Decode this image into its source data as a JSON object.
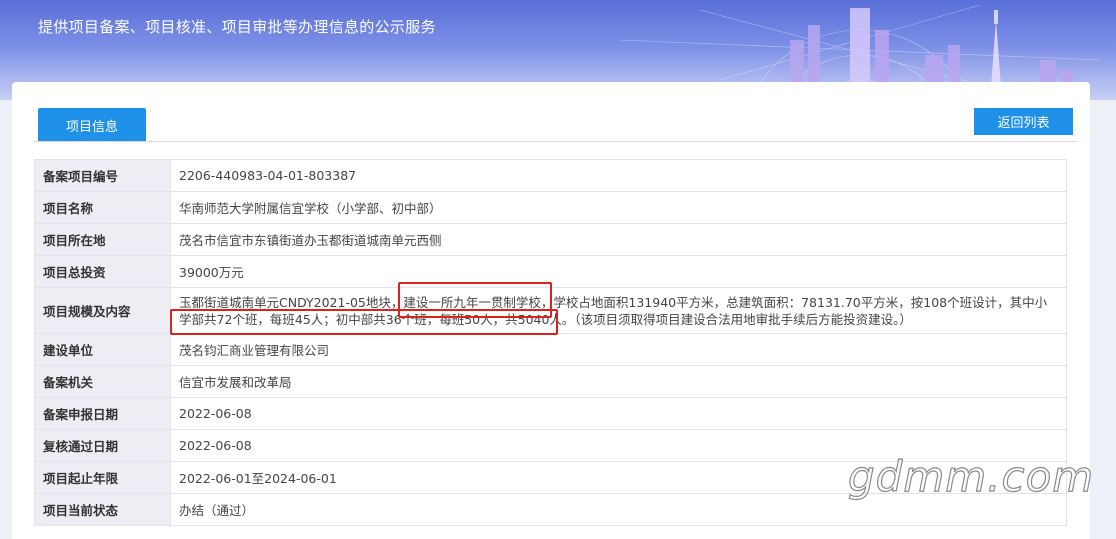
{
  "banner": {
    "title": "提供项目备案、项目核准、项目审批等办理信息的公示服务"
  },
  "tabs": [
    {
      "label": "项目信息"
    }
  ],
  "back_button": "返回列表",
  "rows": [
    {
      "label": "备案项目编号",
      "value": "2206-440983-04-01-803387"
    },
    {
      "label": "项目名称",
      "value": "华南师范大学附属信宜学校（小学部、初中部）"
    },
    {
      "label": "项目所在地",
      "value": "茂名市信宜市东镇街道办玉都街道城南单元西侧"
    },
    {
      "label": "项目总投资",
      "value": "39000万元"
    },
    {
      "label": "项目规模及内容",
      "value": "玉都街道城南单元CNDY2021-05地块，建设一所九年一贯制学校，学校占地面积131940平方米，总建筑面积：78131.70平方米，按108个班设计，其中小学部共72个班，每班45人；初中部共36个班，每班50人，共5040人。（该项目须取得项目建设合法用地审批手续后方能投资建设。）"
    },
    {
      "label": "建设单位",
      "value": "茂名钧汇商业管理有限公司"
    },
    {
      "label": "备案机关",
      "value": "信宜市发展和改革局"
    },
    {
      "label": "备案申报日期",
      "value": "2022-06-08"
    },
    {
      "label": "复核通过日期",
      "value": "2022-06-08"
    },
    {
      "label": "项目起止年限",
      "value": "2022-06-01至2024-06-01"
    },
    {
      "label": "项目当前状态",
      "value": "办结（通过）"
    }
  ],
  "watermark": "gdmm.com",
  "colors": {
    "accent": "#1e90e8",
    "highlight": "#d9231e",
    "label_bg": "#eceef3",
    "border": "#dfe3ea"
  }
}
